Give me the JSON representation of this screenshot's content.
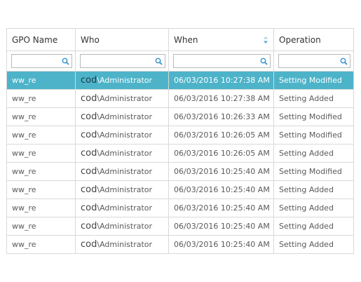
{
  "table": {
    "columns": [
      "GPO Name",
      "Who",
      "When",
      "Operation"
    ],
    "filters": [
      "",
      "",
      "",
      ""
    ],
    "sorted_column_index": 2,
    "accent_color": "#4db3c9",
    "selected_row_index": 0,
    "rows": [
      {
        "gpo": "ww_re",
        "domain": "cod",
        "user": "\\Administrator",
        "when": "06/03/2016 10:27:38 AM",
        "operation": "Setting Modified"
      },
      {
        "gpo": "ww_re",
        "domain": "cod",
        "user": "\\Administrator",
        "when": "06/03/2016 10:27:38 AM",
        "operation": "Setting Added"
      },
      {
        "gpo": "ww_re",
        "domain": "cod",
        "user": "\\Administrator",
        "when": "06/03/2016 10:26:33 AM",
        "operation": "Setting Modified"
      },
      {
        "gpo": "ww_re",
        "domain": "cod",
        "user": "\\Administrator",
        "when": "06/03/2016 10:26:05 AM",
        "operation": "Setting Modified"
      },
      {
        "gpo": "ww_re",
        "domain": "cod",
        "user": "\\Administrator",
        "when": "06/03/2016 10:26:05 AM",
        "operation": "Setting Added"
      },
      {
        "gpo": "ww_re",
        "domain": "cod",
        "user": "\\Administrator",
        "when": "06/03/2016 10:25:40 AM",
        "operation": "Setting Modified"
      },
      {
        "gpo": "ww_re",
        "domain": "cod",
        "user": "\\Administrator",
        "when": "06/03/2016 10:25:40 AM",
        "operation": "Setting Added"
      },
      {
        "gpo": "ww_re",
        "domain": "cod",
        "user": "\\Administrator",
        "when": "06/03/2016 10:25:40 AM",
        "operation": "Setting Added"
      },
      {
        "gpo": "ww_re",
        "domain": "cod",
        "user": "\\Administrator",
        "when": "06/03/2016 10:25:40 AM",
        "operation": "Setting Added"
      },
      {
        "gpo": "ww_re",
        "domain": "cod",
        "user": "\\Administrator",
        "when": "06/03/2016 10:25:40 AM",
        "operation": "Setting Added"
      }
    ]
  }
}
